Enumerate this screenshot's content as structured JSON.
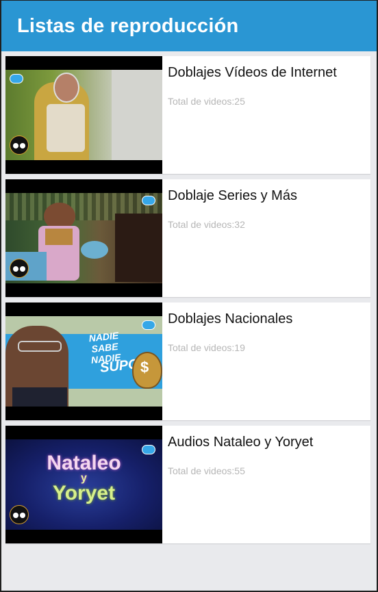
{
  "header": {
    "title": "Listas de reproducción"
  },
  "playlists": [
    {
      "name": "Doblajes Vídeos de Internet",
      "count_text": "Total de videos:25"
    },
    {
      "name": "Doblaje Series y Más",
      "count_text": "Total de videos:32"
    },
    {
      "name": "Doblajes Nacionales",
      "count_text": "Total de videos:19",
      "thumb_text": {
        "l1": "NADIE",
        "l2": "SABE",
        "l3": "NADIE",
        "l4": "SUPO"
      }
    },
    {
      "name": "Audios Nataleo y Yoryet",
      "count_text": "Total de videos:55",
      "thumb_text": {
        "l1": "Nataleo",
        "l2": "y",
        "l3": "Yoryet"
      }
    }
  ],
  "colors": {
    "appbar": "#2a96d3",
    "background": "#e9eaed",
    "subtext": "#b6b6b6"
  }
}
